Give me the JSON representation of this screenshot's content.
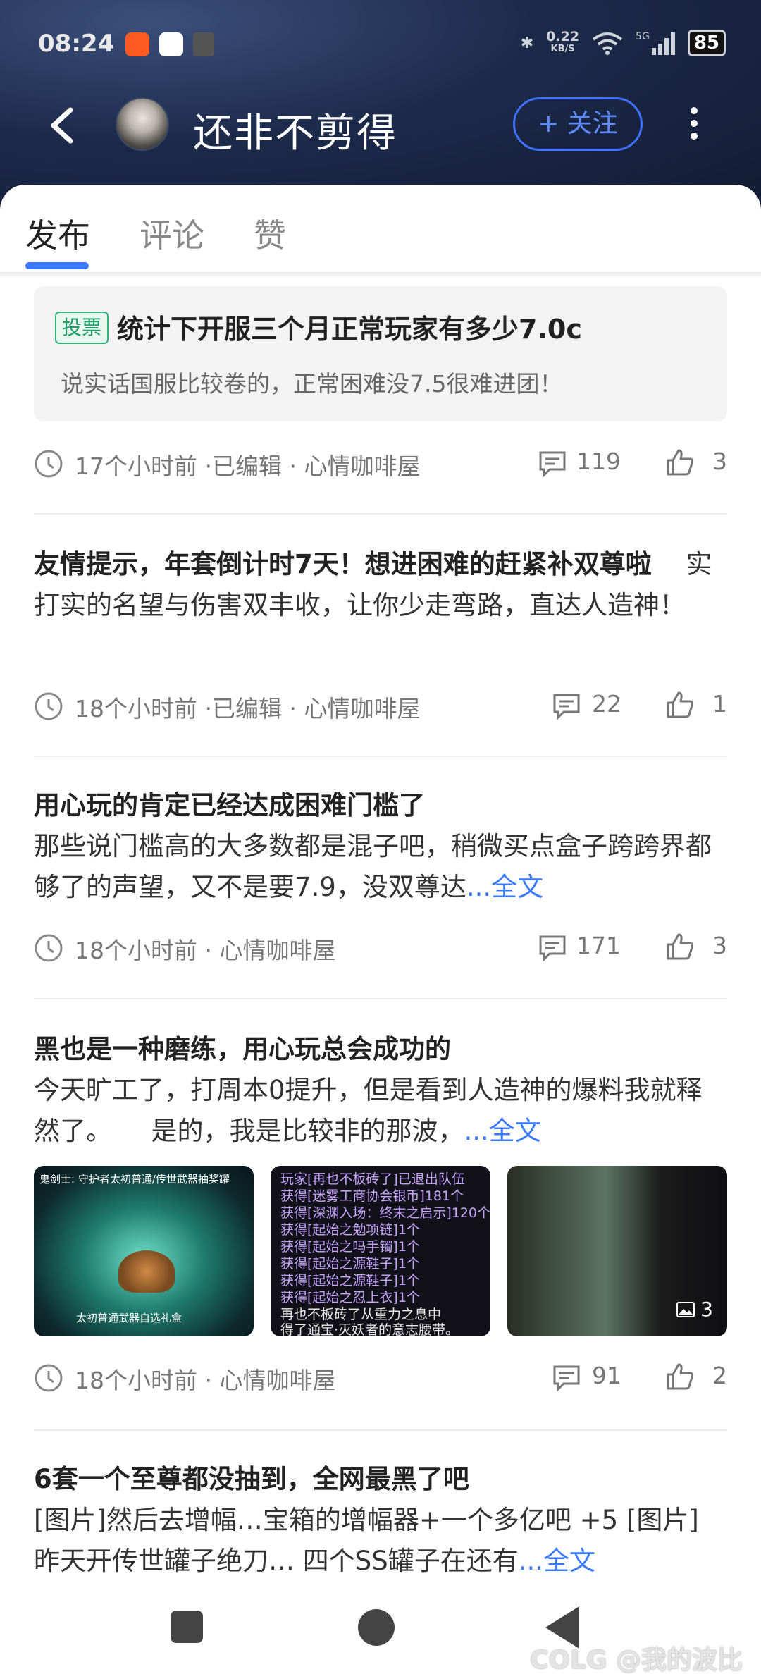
{
  "status_bar": {
    "time": "08:24",
    "net_speed_value": "0.22",
    "net_speed_unit": "KB/S",
    "network": "5G",
    "battery": "85"
  },
  "header": {
    "username": "还非不剪得",
    "follow_label": "+ 关注"
  },
  "tabs": [
    "发布",
    "评论",
    "赞"
  ],
  "posts": [
    {
      "vote_tag": "投票",
      "title": "统计下开服三个月正常玩家有多少7.0c",
      "body": "说实话国服比较卷的，正常困难没7.5很难进团！",
      "time": "17个小时前 ·已编辑 · 心情咖啡屋",
      "comments": "119",
      "likes": "3"
    },
    {
      "title": "友情提示，年套倒计时7天！想进困难的赶紧补双尊啦",
      "body": "实打实的名望与伤害双丰收，让你少走弯路，直达人造神！",
      "time": "18个小时前 ·已编辑 · 心情咖啡屋",
      "comments": "22",
      "likes": "1"
    },
    {
      "title": "用心玩的肯定已经达成困难门槛了",
      "body": "那些说门槛高的大多数都是混子吧，稍微买点盒子跨跨界都够了的声望，又不是要7.9，没双尊达",
      "more": "...全文",
      "time": "18个小时前 · 心情咖啡屋",
      "comments": "171",
      "likes": "3"
    },
    {
      "title": "黑也是一种磨练，用心玩总会成功的",
      "body": "今天旷工了，打周本0提升，但是看到人造神的爆料我就释然了。　　是的，我是比较非的那波，",
      "more": "...全文",
      "image_count": "3",
      "thumb1_header": "鬼剑士: 守护者太初普通/传世武器抽奖罐",
      "thumb1_caption": "太初普通武器自选礼盒",
      "thumb2_lines": [
        "玩家[再也不板砖了]已退出队伍",
        "获得[迷雾工商协会银币]181个",
        "获得[深渊入场：终末之启示]120个",
        "获得[起始之勉项链]1个",
        "获得[起始之吗手镯]1个",
        "获得[起始之源鞋子]1个",
        "获得[起始之源鞋子]1个",
        "获得[起始之忍上衣]1个",
        "再也不板砖了从重力之息中",
        "得了通宝·灭妖者的意志腰带。"
      ],
      "time": "18个小时前 · 心情咖啡屋",
      "comments": "91",
      "likes": "2"
    },
    {
      "title": "6套一个至尊都没抽到，全网最黑了吧",
      "body": "[图片]然后去增幅…宝箱的增幅器+一个多亿吧 +5 [图片] 昨天开传世罐子绝刀… 四个SS罐子在还有",
      "more": "...全文"
    }
  ],
  "watermark": "COLG @我的波比",
  "colors": {
    "accent": "#3a79ff",
    "vote_green": "#1a9e64",
    "header_bg": "#1c2a4a"
  }
}
